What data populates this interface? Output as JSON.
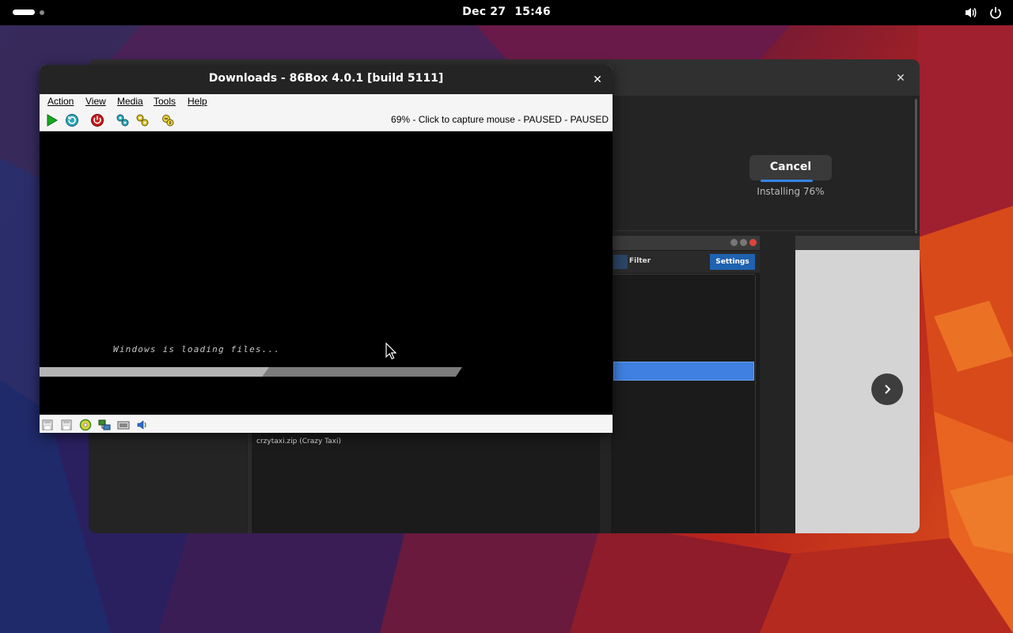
{
  "topbar": {
    "date": "Dec 27",
    "time": "15:46",
    "icons": [
      "activities-indicator",
      "volume-icon",
      "power-icon"
    ]
  },
  "software_window": {
    "cancel_label": "Cancel",
    "install_status": "Installing 76%",
    "install_progress": 0.76,
    "screenshot_filter_label": "Filter",
    "screenshot_settings_label": "Settings",
    "file_label": "crzytaxi.zip (Crazy Taxi)",
    "next_icon": "chevron-right-icon"
  },
  "box86_window": {
    "title": "Downloads - 86Box 4.0.1 [build 5111]",
    "menu": [
      "Action",
      "View",
      "Media",
      "Tools",
      "Help"
    ],
    "toolbar_icons": [
      "play-icon",
      "reset-icon",
      "power-off-icon",
      "settings-icon",
      "ctrl-alt-del-icon",
      "screenshot-icon"
    ],
    "status_text": "69% - Click to capture mouse - PAUSED - PAUSED",
    "screen_text": "Windows is loading files...",
    "loading_progress": 0.54,
    "statusbar_icons": [
      "floppy-a-icon",
      "floppy-b-icon",
      "cdrom-icon",
      "network-icon",
      "keyboard-icon",
      "sound-icon"
    ]
  },
  "colors": {
    "accent": "#3584e4",
    "settings_button": "#1f62b0",
    "topbar": "#000000",
    "window_header": "#242424"
  }
}
